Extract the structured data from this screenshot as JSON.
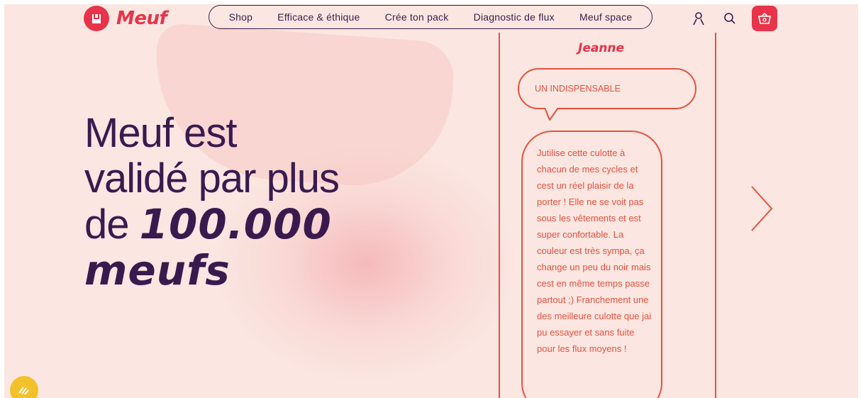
{
  "brand": {
    "name": "Meuf",
    "color": "#e8344a"
  },
  "nav": {
    "items": [
      {
        "label": "Shop"
      },
      {
        "label": "Efficace & éthique"
      },
      {
        "label": "Crée ton pack"
      },
      {
        "label": "Diagnostic de flux"
      },
      {
        "label": "Meuf space"
      }
    ]
  },
  "header_icons": [
    "account-icon",
    "search-icon",
    "cart-icon"
  ],
  "hero": {
    "line1": "Meuf est",
    "line2": "validé par plus",
    "line3_prefix": "de ",
    "line3_bold": "100.000",
    "line4_bold": "meufs"
  },
  "review": {
    "reviewer": "Jeanne",
    "title": "UN INDISPENSABLE",
    "text": "Jutilise cette culotte à chacun de mes cycles et cest un réel plaisir de la porter ! Elle ne se voit pas sous les vêtements et est super confortable. La couleur est très sympa, ça change un peu du noir mais cest en même temps passe partout ;) Franchement une des meilleure culotte que jai pu essayer et sans fuite pour les flux moyens !"
  },
  "colors": {
    "background": "#fbe6e1",
    "headline": "#3a1a4e",
    "accent": "#e8513f",
    "badge": "#f3c22a"
  }
}
